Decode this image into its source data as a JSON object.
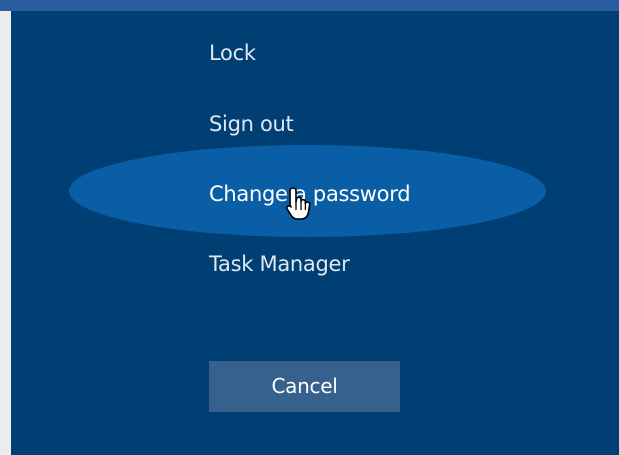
{
  "security_options": {
    "items": [
      {
        "id": "lock",
        "label": "Lock"
      },
      {
        "id": "sign-out",
        "label": "Sign out"
      },
      {
        "id": "change-password",
        "label": "Change a password"
      },
      {
        "id": "task-manager",
        "label": "Task Manager"
      }
    ],
    "cancel_label": "Cancel",
    "highlighted_item": "change-password"
  },
  "colors": {
    "background": "#003f73",
    "highlight": "#0a5ea6",
    "button": "#36618c",
    "topbar": "#2a5ca0",
    "text": "#ffffff"
  },
  "icons": {
    "cursor": "hand-pointer-icon"
  }
}
